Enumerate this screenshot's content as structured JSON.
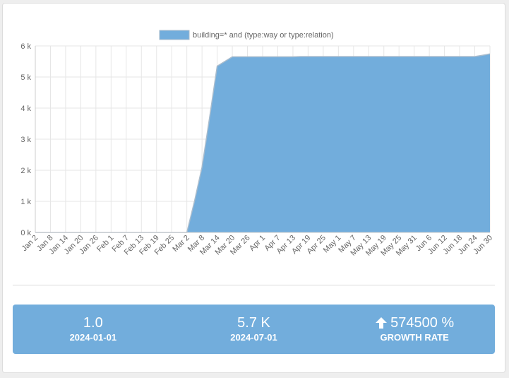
{
  "colors": {
    "fill": "#72addc",
    "stroke": "#a9bccd",
    "grid": "#e6e6e6",
    "panel": "#72addc"
  },
  "chart_data": {
    "type": "area",
    "legend": "building=* and (type:way or type:relation)",
    "legend_position": "top",
    "grid": true,
    "x": [
      "Jan 2",
      "Jan 5",
      "Jan 8",
      "Jan 11",
      "Jan 14",
      "Jan 17",
      "Jan 20",
      "Jan 23",
      "Jan 26",
      "Jan 29",
      "Feb 1",
      "Feb 4",
      "Feb 7",
      "Feb 10",
      "Feb 13",
      "Feb 16",
      "Feb 19",
      "Feb 22",
      "Feb 25",
      "Feb 28",
      "Mar 2",
      "Mar 5",
      "Mar 8",
      "Mar 11",
      "Mar 14",
      "Mar 17",
      "Mar 20",
      "Mar 23",
      "Mar 26",
      "Mar 29",
      "Apr 1",
      "Apr 4",
      "Apr 7",
      "Apr 10",
      "Apr 13",
      "Apr 16",
      "Apr 19",
      "Apr 22",
      "Apr 25",
      "Apr 28",
      "May 1",
      "May 4",
      "May 7",
      "May 10",
      "May 13",
      "May 16",
      "May 19",
      "May 22",
      "May 25",
      "May 28",
      "May 31",
      "Jun 3",
      "Jun 6",
      "Jun 9",
      "Jun 12",
      "Jun 15",
      "Jun 18",
      "Jun 21",
      "Jun 24",
      "Jun 27",
      "Jun 30"
    ],
    "tick_labels": [
      "Jan 2",
      "Jan 8",
      "Jan 14",
      "Jan 20",
      "Jan 26",
      "Feb 1",
      "Feb 7",
      "Feb 13",
      "Feb 19",
      "Feb 25",
      "Mar 2",
      "Mar 8",
      "Mar 14",
      "Mar 20",
      "Mar 26",
      "Apr 1",
      "Apr 7",
      "Apr 13",
      "Apr 19",
      "Apr 25",
      "May 1",
      "May 7",
      "May 13",
      "May 19",
      "May 25",
      "May 31",
      "Jun 6",
      "Jun 12",
      "Jun 18",
      "Jun 24",
      "Jun 30"
    ],
    "y": [
      0,
      0,
      0,
      0,
      0,
      0,
      0,
      0,
      0,
      0,
      0,
      0,
      0,
      0,
      0,
      0,
      0,
      0,
      0,
      0,
      0,
      1000,
      2100,
      3700,
      5350,
      5500,
      5650,
      5650,
      5650,
      5650,
      5650,
      5650,
      5650,
      5650,
      5650,
      5660,
      5660,
      5660,
      5660,
      5660,
      5660,
      5660,
      5660,
      5660,
      5660,
      5660,
      5660,
      5660,
      5660,
      5660,
      5660,
      5660,
      5660,
      5660,
      5660,
      5660,
      5660,
      5660,
      5660,
      5700,
      5745
    ],
    "ylim": [
      0,
      6000
    ],
    "y_ticks": [
      "0 k",
      "1 k",
      "2 k",
      "3 k",
      "4 k",
      "5 k",
      "6 k"
    ]
  },
  "stats": [
    {
      "value": "1.0",
      "label": "2024-01-01"
    },
    {
      "value": "5.7 K",
      "label": "2024-07-01"
    },
    {
      "value": "574500 %",
      "label": "GROWTH RATE",
      "icon": "arrow-up-icon"
    }
  ]
}
